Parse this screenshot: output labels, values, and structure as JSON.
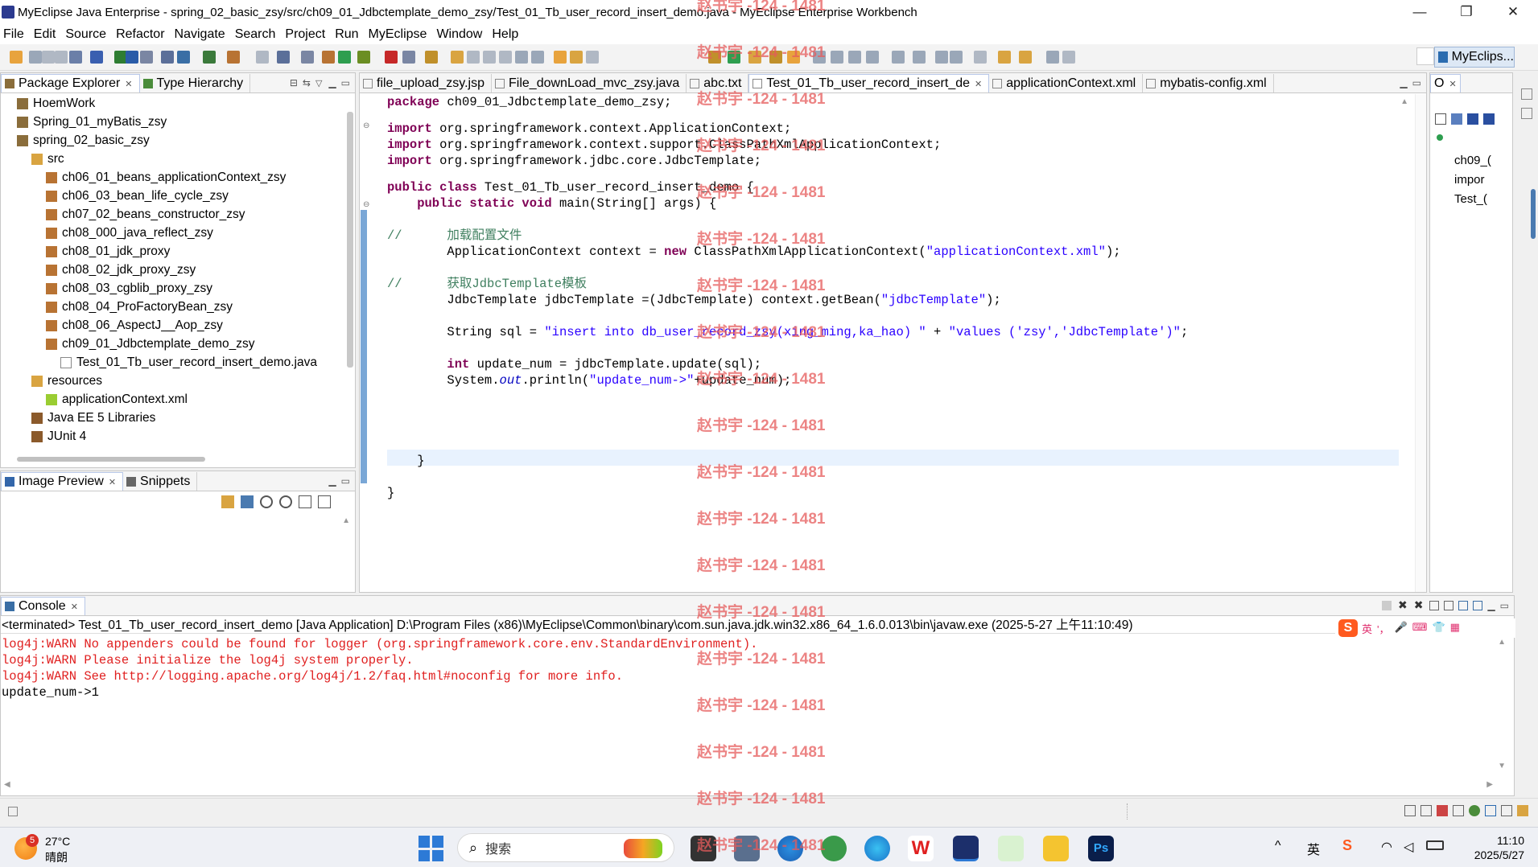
{
  "window": {
    "title": "MyEclipse Java Enterprise - spring_02_basic_zsy/src/ch09_01_Jdbctemplate_demo_zsy/Test_01_Tb_user_record_insert_demo.java - MyEclipse Enterprise Workbench",
    "minimize": "—",
    "restore": "❐",
    "close": "✕"
  },
  "menu": [
    "File",
    "Edit",
    "Source",
    "Refactor",
    "Navigate",
    "Search",
    "Project",
    "Run",
    "MyEclipse",
    "Window",
    "Help"
  ],
  "perspective": "MyEclips...",
  "package_explorer": {
    "tabs": [
      "Package Explorer",
      "Type Hierarchy"
    ],
    "items": [
      {
        "label": "HoemWork",
        "indent": 0,
        "icon": "project-icon"
      },
      {
        "label": "Spring_01_myBatis_zsy",
        "indent": 0,
        "icon": "project-icon"
      },
      {
        "label": "spring_02_basic_zsy",
        "indent": 0,
        "icon": "project-icon"
      },
      {
        "label": "src",
        "indent": 1,
        "icon": "source-folder-icon"
      },
      {
        "label": "ch06_01_beans_applicationContext_zsy",
        "indent": 2,
        "icon": "package-icon"
      },
      {
        "label": "ch06_03_bean_life_cycle_zsy",
        "indent": 2,
        "icon": "package-icon"
      },
      {
        "label": "ch07_02_beans_constructor_zsy",
        "indent": 2,
        "icon": "package-icon"
      },
      {
        "label": "ch08_000_java_reflect_zsy",
        "indent": 2,
        "icon": "package-icon"
      },
      {
        "label": "ch08_01_jdk_proxy",
        "indent": 2,
        "icon": "package-icon"
      },
      {
        "label": "ch08_02_jdk_proxy_zsy",
        "indent": 2,
        "icon": "package-icon"
      },
      {
        "label": "ch08_03_cgblib_proxy_zsy",
        "indent": 2,
        "icon": "package-icon"
      },
      {
        "label": "ch08_04_ProFactoryBean_zsy",
        "indent": 2,
        "icon": "package-icon"
      },
      {
        "label": "ch08_06_AspectJ__Aop_zsy",
        "indent": 2,
        "icon": "package-icon"
      },
      {
        "label": "ch09_01_Jdbctemplate_demo_zsy",
        "indent": 2,
        "icon": "package-icon"
      },
      {
        "label": "Test_01_Tb_user_record_insert_demo.java",
        "indent": 3,
        "icon": "java-file-icon"
      },
      {
        "label": "resources",
        "indent": 1,
        "icon": "source-folder-icon"
      },
      {
        "label": "applicationContext.xml",
        "indent": 2,
        "icon": "xml-file-icon"
      },
      {
        "label": "Java EE 5 Libraries",
        "indent": 1,
        "icon": "library-icon"
      },
      {
        "label": "JUnit 4",
        "indent": 1,
        "icon": "library-icon"
      }
    ]
  },
  "image_preview": {
    "tabs": [
      "Image Preview",
      "Snippets"
    ]
  },
  "editor": {
    "tabs": [
      {
        "label": "file_upload_zsy.jsp",
        "active": false
      },
      {
        "label": "File_downLoad_mvc_zsy.java",
        "active": false
      },
      {
        "label": "abc.txt",
        "active": false
      },
      {
        "label": "Test_01_Tb_user_record_insert_de",
        "active": true
      },
      {
        "label": "applicationContext.xml",
        "active": false
      },
      {
        "label": "mybatis-config.xml",
        "active": false
      }
    ],
    "lines": [
      [
        {
          "t": "package",
          "c": "kw"
        },
        {
          "t": " ch09_01_Jdbctemplate_demo_zsy;",
          "c": ""
        }
      ],
      [],
      [
        {
          "t": "import",
          "c": "kw"
        },
        {
          "t": " org.springframework.context.ApplicationContext;",
          "c": ""
        }
      ],
      [
        {
          "t": "import",
          "c": "kw"
        },
        {
          "t": " org.springframework.context.support.ClassPathXmlApplicationContext;",
          "c": ""
        }
      ],
      [
        {
          "t": "import",
          "c": "kw"
        },
        {
          "t": " org.springframework.jdbc.core.JdbcTemplate;",
          "c": ""
        }
      ],
      [],
      [
        {
          "t": "public class",
          "c": "kw"
        },
        {
          "t": " Test_01_Tb_user_record_insert_demo {",
          "c": ""
        }
      ],
      [
        {
          "t": "    public static void",
          "c": "kw"
        },
        {
          "t": " main(String[] args) {",
          "c": ""
        }
      ],
      [],
      [
        {
          "t": "//      加载配置文件",
          "c": "cm"
        }
      ],
      [
        {
          "t": "        ApplicationContext context = ",
          "c": ""
        },
        {
          "t": "new",
          "c": "kw"
        },
        {
          "t": " ClassPathXmlApplicationContext(",
          "c": ""
        },
        {
          "t": "\"applicationContext.xml\"",
          "c": "str"
        },
        {
          "t": ");",
          "c": ""
        }
      ],
      [],
      [
        {
          "t": "//      获取JdbcTemplate模板",
          "c": "cm"
        }
      ],
      [
        {
          "t": "        JdbcTemplate jdbcTemplate =(JdbcTemplate) context.getBean(",
          "c": ""
        },
        {
          "t": "\"jdbcTemplate\"",
          "c": "str"
        },
        {
          "t": ");",
          "c": ""
        }
      ],
      [],
      [
        {
          "t": "        String sql = ",
          "c": ""
        },
        {
          "t": "\"insert into db_user_record_zsy(xing_ming,ka_hao) \"",
          "c": "str"
        },
        {
          "t": " + ",
          "c": ""
        },
        {
          "t": "\"values ('zsy','JdbcTemplate')\"",
          "c": "str"
        },
        {
          "t": ";",
          "c": ""
        }
      ],
      [],
      [
        {
          "t": "        ",
          "c": ""
        },
        {
          "t": "int",
          "c": "kw"
        },
        {
          "t": " update_num = jdbcTemplate.update(sql);",
          "c": ""
        }
      ],
      [
        {
          "t": "        System.",
          "c": ""
        },
        {
          "t": "out",
          "c": "ital"
        },
        {
          "t": ".println(",
          "c": ""
        },
        {
          "t": "\"update_num->\"",
          "c": "str"
        },
        {
          "t": "+update_num);",
          "c": ""
        }
      ],
      [],
      [],
      [],
      [],
      [
        {
          "t": "    }",
          "c": ""
        }
      ],
      [],
      [
        {
          "t": "}",
          "c": ""
        }
      ]
    ]
  },
  "outline": {
    "tab": "O",
    "items": [
      "ch09_(",
      "impor",
      "Test_("
    ]
  },
  "console": {
    "tab": "Console",
    "header": "<terminated> Test_01_Tb_user_record_insert_demo [Java Application] D:\\Program Files (x86)\\MyEclipse\\Common\\binary\\com.sun.java.jdk.win32.x86_64_1.6.0.013\\bin\\javaw.exe (2025-5-27 上午11:10:49)",
    "lines": [
      {
        "text": "log4j:WARN No appenders could be found for logger (org.springframework.core.env.StandardEnvironment).",
        "err": true
      },
      {
        "text": "log4j:WARN Please initialize the log4j system properly.",
        "err": true
      },
      {
        "text": "log4j:WARN See http://logging.apache.org/log4j/1.2/faq.html#noconfig for more info.",
        "err": true
      },
      {
        "text": "update_num->1",
        "err": false
      }
    ],
    "ime": [
      "英",
      "'，",
      "🎤",
      "⌨",
      "👕",
      "▦"
    ]
  },
  "watermark": "赵书宇 -124 - 1481",
  "taskbar": {
    "weather_temp": "27°C",
    "weather_desc": "晴朗",
    "weather_badge": "5",
    "search_placeholder": "搜索",
    "time": "11:10",
    "date": "2025/5/27",
    "tray": [
      "^",
      "英",
      "S"
    ]
  }
}
